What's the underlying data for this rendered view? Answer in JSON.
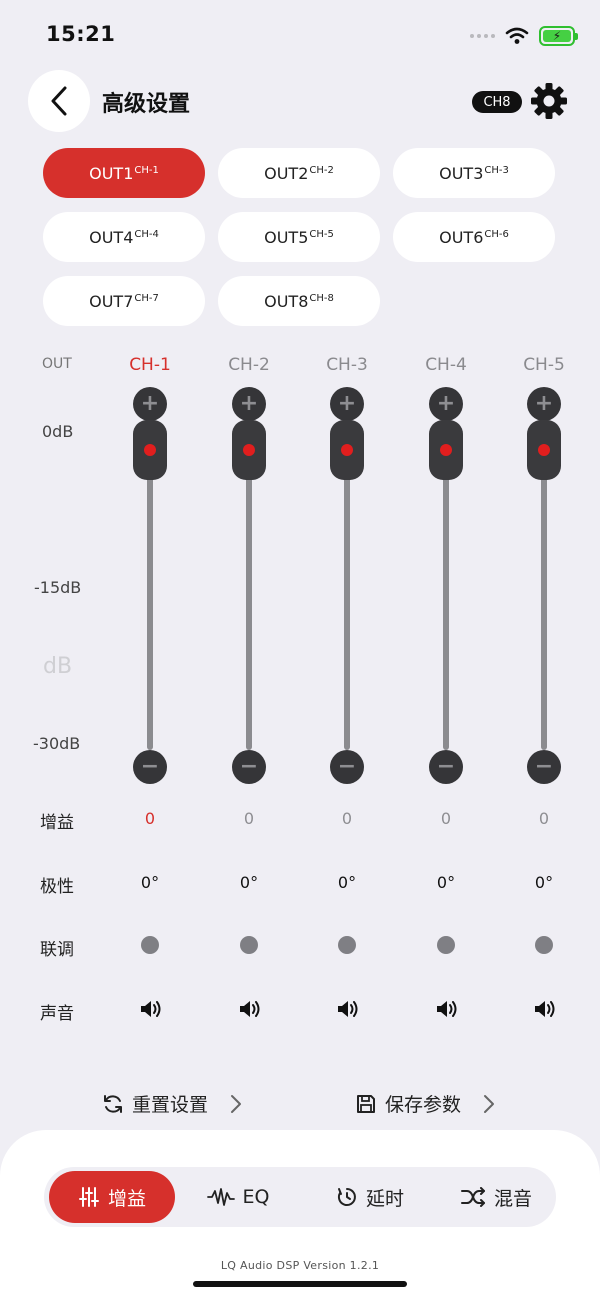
{
  "status_bar": {
    "time": "15:21"
  },
  "header": {
    "title": "高级设置",
    "channel_badge": "CH8"
  },
  "outputs": [
    {
      "name": "OUT1",
      "ch": "CH-1",
      "active": true
    },
    {
      "name": "OUT2",
      "ch": "CH-2",
      "active": false
    },
    {
      "name": "OUT3",
      "ch": "CH-3",
      "active": false
    },
    {
      "name": "OUT4",
      "ch": "CH-4",
      "active": false
    },
    {
      "name": "OUT5",
      "ch": "CH-5",
      "active": false
    },
    {
      "name": "OUT6",
      "ch": "CH-6",
      "active": false
    },
    {
      "name": "OUT7",
      "ch": "CH-7",
      "active": false
    },
    {
      "name": "OUT8",
      "ch": "CH-8",
      "active": false
    }
  ],
  "mixer": {
    "out_label": "OUT",
    "db_scale": {
      "top": "0dB",
      "middle": "-15dB",
      "unit": "dB",
      "bottom": "-30dB"
    },
    "row_labels": {
      "gain": "增益",
      "polarity": "极性",
      "link": "联调",
      "sound": "声音"
    },
    "channels": [
      {
        "name": "CH-1",
        "gain": "0",
        "polarity": "0°",
        "level": 0,
        "active": true
      },
      {
        "name": "CH-2",
        "gain": "0",
        "polarity": "0°",
        "level": 0,
        "active": false
      },
      {
        "name": "CH-3",
        "gain": "0",
        "polarity": "0°",
        "level": 0,
        "active": false
      },
      {
        "name": "CH-4",
        "gain": "0",
        "polarity": "0°",
        "level": 0,
        "active": false
      },
      {
        "name": "CH-5",
        "gain": "0",
        "polarity": "0°",
        "level": 0,
        "active": false
      }
    ]
  },
  "actions": {
    "reset": "重置设置",
    "save": "保存参数"
  },
  "tabs": [
    {
      "label": "增益",
      "icon": "sliders-icon",
      "active": true
    },
    {
      "label": "EQ",
      "icon": "waveform-icon",
      "active": false
    },
    {
      "label": "延时",
      "icon": "timer-icon",
      "active": false
    },
    {
      "label": "混音",
      "icon": "shuffle-icon",
      "active": false
    }
  ],
  "version": "LQ Audio DSP Version 1.2.1",
  "colors": {
    "accent": "#d6302c",
    "background": "#efeef4",
    "knob": "#3a3a3d"
  }
}
